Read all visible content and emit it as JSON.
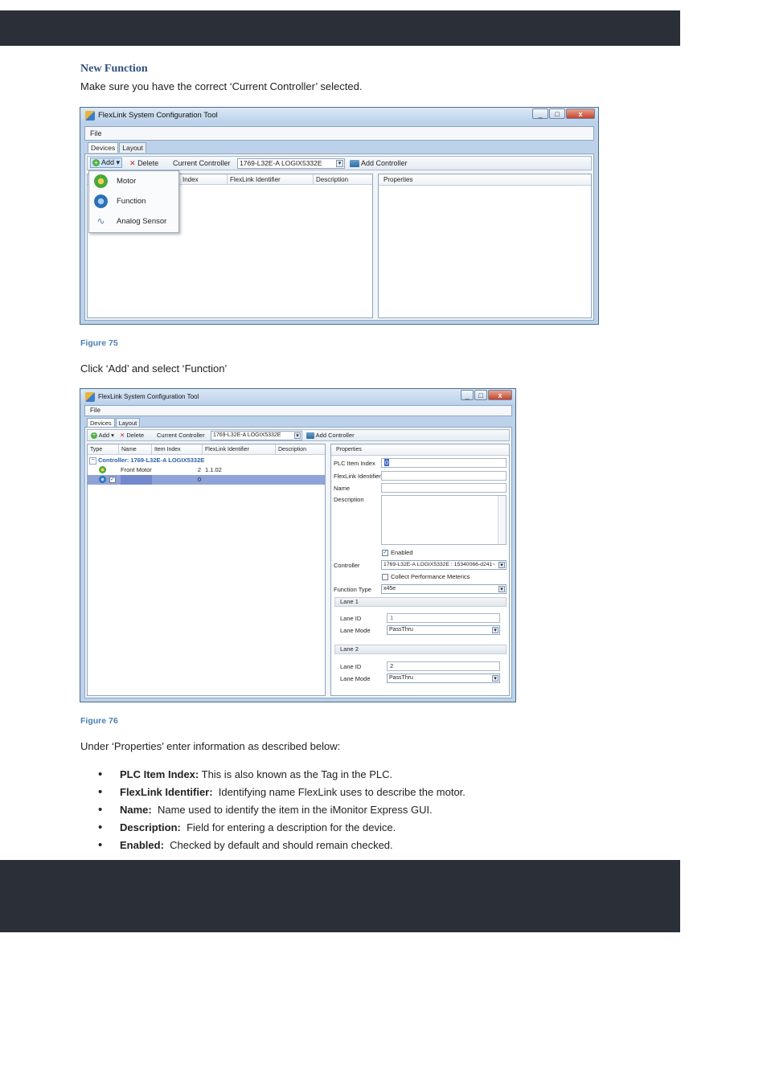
{
  "heading": "New Function",
  "intro": "Make sure you have the correct ‘Current Controller’ selected.",
  "figure75": {
    "caption": "Figure 75",
    "window_title": "FlexLink System Configuration Tool",
    "menu_file": "File",
    "tabs": [
      "Devices",
      "Layout"
    ],
    "toolbar": {
      "add": "Add",
      "delete": "Delete",
      "current_controller_label": "Current Controller",
      "current_controller_value": "1769-L32E-A LOGIX5332E",
      "add_controller": "Add Controller"
    },
    "columns": [
      "Index",
      "FlexLink Identifier",
      "Description"
    ],
    "properties_header": "Properties",
    "add_menu": [
      "Motor",
      "Function",
      "Analog Sensor"
    ],
    "icons": {
      "motor": "motor-green-icon",
      "function": "function-blue-icon",
      "sensor": "analog-sensor-icon"
    }
  },
  "step_text": "Click ‘Add’ and select ‘Function’",
  "figure76": {
    "caption": "Figure 76",
    "window_title": "FlexLink System Configuration Tool",
    "menu_file": "File",
    "tabs": [
      "Devices",
      "Layout"
    ],
    "toolbar": {
      "add": "Add",
      "delete": "Delete",
      "current_controller_label": "Current Controller",
      "current_controller_value": "1769-L32E-A LOGIX5332E",
      "add_controller": "Add Controller"
    },
    "columns": [
      "Type",
      "Name",
      "Item Index",
      "FlexLink Identifier",
      "Description"
    ],
    "group_row": "Controller: 1769-L32E-A LOGIX5332E",
    "rows": [
      {
        "name": "Front Motor",
        "item_index": "2",
        "identifier": "1.1.02"
      },
      {
        "name": "",
        "item_index": "0",
        "identifier": ""
      }
    ],
    "properties": {
      "header": "Properties",
      "plc_item_index_label": "PLC Item Index",
      "plc_item_index_value": "0",
      "flexlink_identifier_label": "FlexLink Identifier",
      "name_label": "Name",
      "description_label": "Description",
      "enabled_label": "Enabled",
      "controller_label": "Controller",
      "controller_value": "1769-L32E-A LOGIX5332E : 15340066-d241~",
      "collect_label": "Collect Performance Meterics",
      "function_type_label": "Function Type",
      "function_type_value": "x45e",
      "lane1_header": "Lane 1",
      "lane1_id_label": "Lane ID",
      "lane1_id_value": "1",
      "lane1_mode_label": "Lane Mode",
      "lane1_mode_value": "PassThru",
      "lane2_header": "Lane 2",
      "lane2_id_label": "Lane ID",
      "lane2_id_value": "2",
      "lane2_mode_label": "Lane Mode",
      "lane2_mode_value": "PassThru"
    }
  },
  "props_intro": "Under ‘Properties’ enter information as described below:",
  "bullets": [
    {
      "term": "PLC Item Index:",
      "text": " This is also known as the Tag in the PLC."
    },
    {
      "term": "FlexLink Identifier:",
      "text": "  Identifying name FlexLink uses to describe the motor."
    },
    {
      "term": "Name:",
      "text": "  Name used to identify the item in the iMonitor Express GUI."
    },
    {
      "term": "Description:",
      "text": "  Field for entering a description for the device."
    },
    {
      "term": "Enabled:",
      "text": "  Checked by default and should remain checked."
    }
  ]
}
